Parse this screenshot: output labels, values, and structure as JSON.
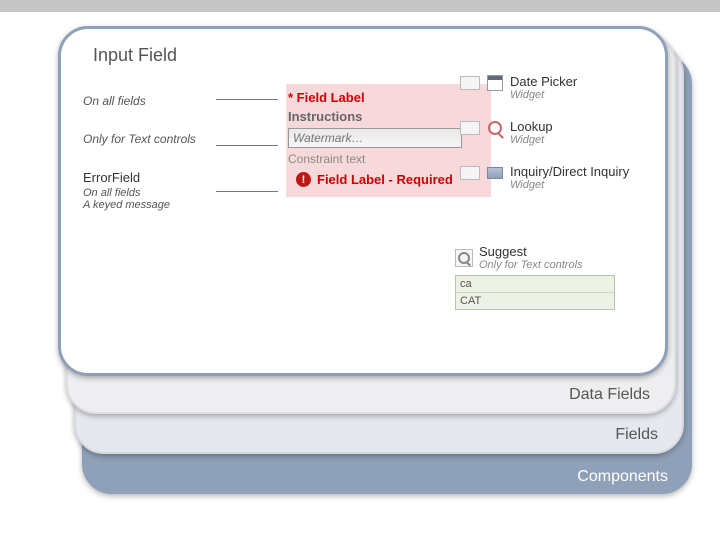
{
  "title": "Input Field",
  "layers": {
    "data": "Data Fields",
    "fields": "Fields",
    "components": "Components"
  },
  "left": {
    "all_fields": "On all fields",
    "text_only": "Only for Text controls",
    "error_title": "ErrorField",
    "error_note1": "On all fields",
    "error_note2": "A keyed message"
  },
  "mid": {
    "field_label": "* Field Label",
    "instructions": "Instructions",
    "watermark": "Watermark…",
    "constraint": "Constraint text",
    "error_msg": "Field Label - Required"
  },
  "right": {
    "items": [
      {
        "name": "Date Picker",
        "sub": "Widget",
        "icon": "calendar"
      },
      {
        "name": "Lookup",
        "sub": "Widget",
        "icon": "lookup"
      },
      {
        "name": "Inquiry/Direct Inquiry",
        "sub": "Widget",
        "icon": "book"
      }
    ],
    "suggest": {
      "name": "Suggest",
      "sub": "Only for Text controls",
      "rows": [
        "ca",
        "CAT"
      ]
    }
  }
}
